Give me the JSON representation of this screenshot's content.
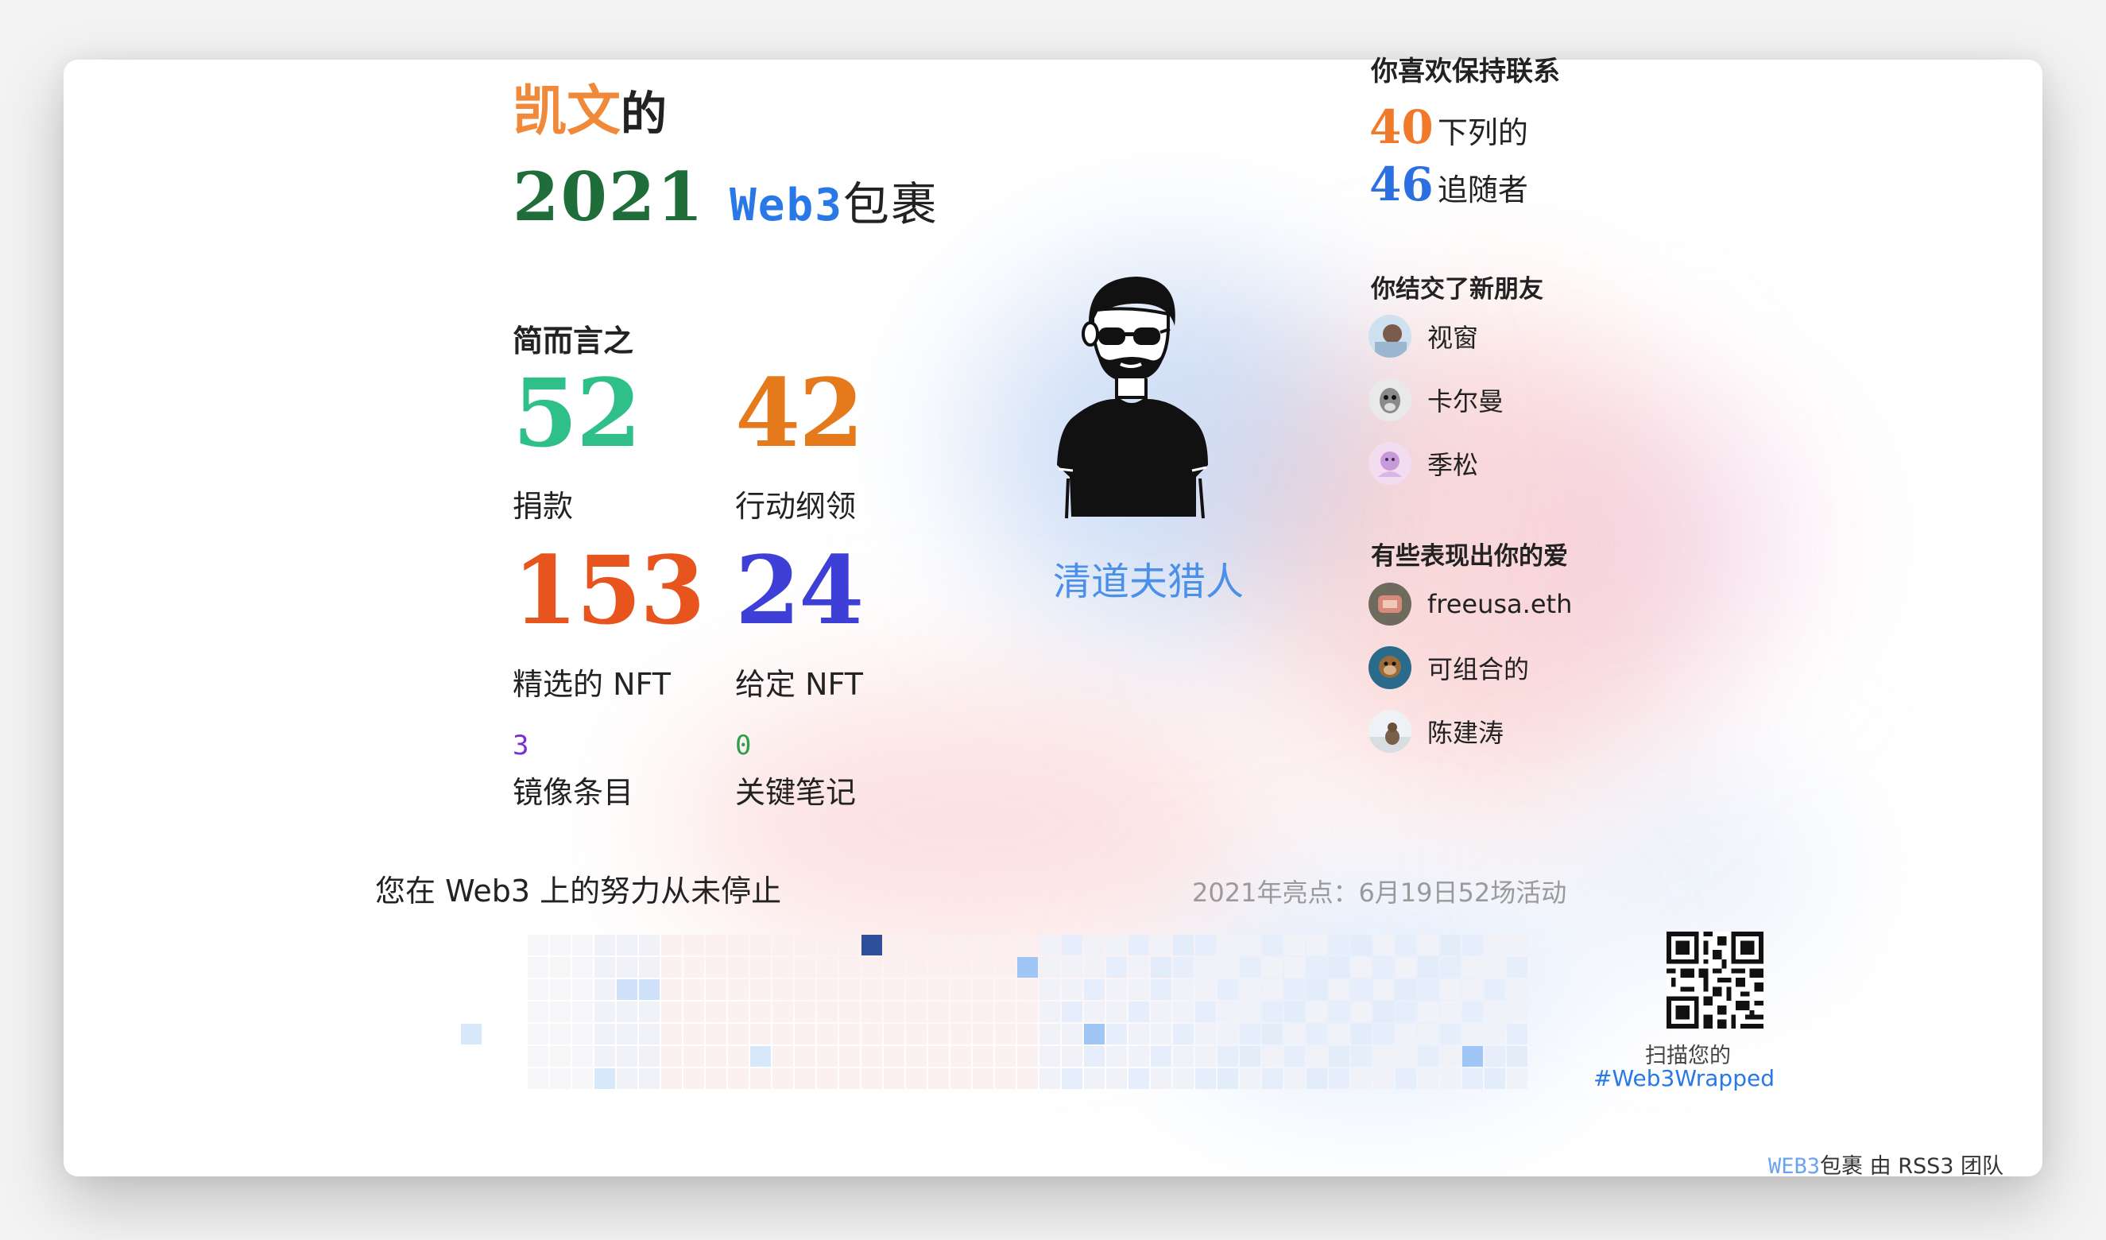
{
  "header": {
    "name": "凯文",
    "possessive": "的",
    "year": "2021",
    "web3": "Web3",
    "package": "包裹"
  },
  "summary": {
    "heading": "简而言之",
    "stats": [
      {
        "value": "52",
        "label": "捐款",
        "color": "#2fc08a"
      },
      {
        "value": "42",
        "label": "行动纲领",
        "color": "#e47a1c"
      },
      {
        "value": "153",
        "label": "精选的 NFT",
        "color": "#e8541e"
      },
      {
        "value": "24",
        "label": "给定 NFT",
        "color": "#3d3fd6"
      }
    ],
    "minor": [
      {
        "value": "3",
        "label": "镜像条目",
        "color": "#7a2fd0"
      },
      {
        "value": "0",
        "label": "关键笔记",
        "color": "#2fa04a"
      }
    ]
  },
  "profile": {
    "nickname": "清道夫猎人"
  },
  "connections": {
    "heading": "你喜欢保持联系",
    "following": {
      "value": "40",
      "label": "下列的",
      "color": "#f07a2a"
    },
    "followers": {
      "value": "46",
      "label": "追随者",
      "color": "#2b6fe0"
    }
  },
  "new_friends": {
    "heading": "你结交了新朋友",
    "items": [
      {
        "name": "视窗"
      },
      {
        "name": "卡尔曼"
      },
      {
        "name": "季松"
      }
    ]
  },
  "love": {
    "heading": "有些表现出你的爱",
    "items": [
      {
        "name": "freeusa.eth"
      },
      {
        "name": "可组合的"
      },
      {
        "name": "陈建涛"
      }
    ]
  },
  "activity": {
    "title": "您在 Web3 上的努力从未停止",
    "highlight": "2021年亮点：6月19日52场活动"
  },
  "share": {
    "scan_text": "扫描您的",
    "hashtag": "#Web3Wrapped"
  },
  "footer": {
    "brand": "WEB3",
    "rest": "包裹 由  RSS3 团队"
  }
}
